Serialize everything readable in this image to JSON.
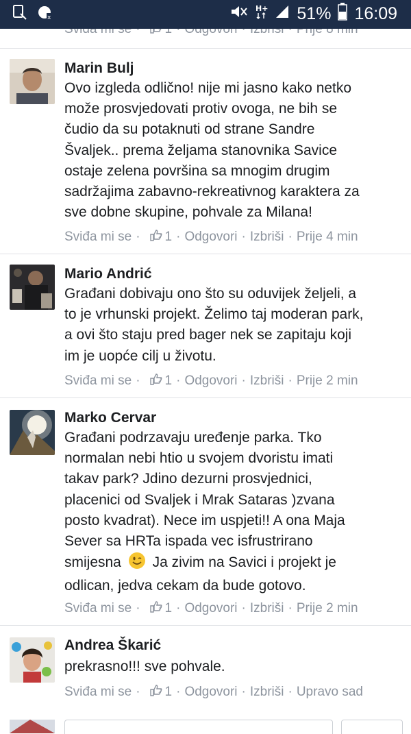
{
  "statusbar": {
    "battery": "51%",
    "time": "16:09"
  },
  "actions": {
    "like": "Sviđa mi se",
    "reply": "Odgovori",
    "delete": "Izbriši",
    "separator": "·"
  },
  "top_partial": {
    "like": "Sviđa mi se",
    "count": "1",
    "reply": "Odgovori",
    "delete": "Izbriši",
    "time": "Prije 8 min"
  },
  "comments": [
    {
      "author": "Marin Bulj",
      "lines": [
        "Ovo izgleda odlično! nije mi jasno kako netko",
        "može prosvjedovati protiv ovoga, ne bih se",
        "čudio da su potaknuti od strane Sandre",
        "Švaljek.. prema željama stanovnika Savice",
        "ostaje zelena površina sa mnogim drugim",
        "sadržajima zabavno-rekreativnog karaktera za",
        "sve dobne skupine, pohvale za Milana!"
      ],
      "likes": "1",
      "time": "Prije 4 min"
    },
    {
      "author": "Mario Andrić",
      "lines": [
        "Građani dobivaju ono što su oduvijek željeli, a",
        "to je vrhunski projekt. Želimo taj moderan park,",
        "a ovi što staju pred bager nek se zapitaju koji",
        "im je uopće cilj u životu."
      ],
      "likes": "1",
      "time": "Prije 2 min"
    },
    {
      "author": "Marko Cervar",
      "lines": [
        "Građani podrzavaju uređenje parka. Tko",
        "normalan nebi htio u svojem dvoristu imati",
        "takav park? Jdino dezurni prosvjednici,",
        "placenici od Svaljek i Mrak Sataras )zvana",
        "posto kvadrat). Nece im uspjeti!! A ona Maja",
        "Sever sa HRTa ispada vec isfrustrirano",
        "smijesna",
        "Ja zivim na Savici i projekt je",
        "odlican, jedva cekam da bude gotovo."
      ],
      "likes": "1",
      "time": "Prije 2 min"
    },
    {
      "author": "Andrea Škarić",
      "lines": [
        "prekrasno!!! sve pohvale."
      ],
      "likes": "1",
      "time": "Upravo sad"
    }
  ]
}
